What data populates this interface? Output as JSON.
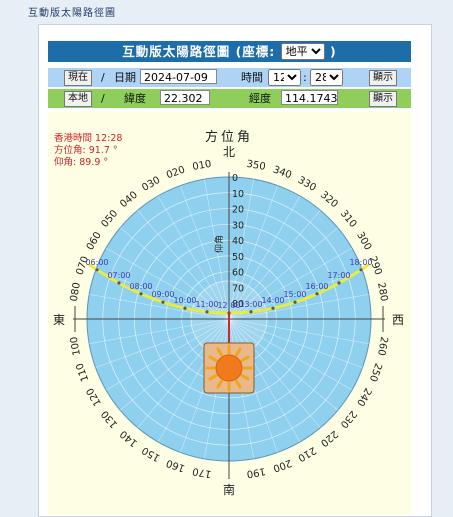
{
  "page_title": "互動版太陽路徑圖",
  "header": {
    "title": "互動版太陽路徑圖 (座標:",
    "coord_select": "地平",
    "close_paren": ")"
  },
  "row1": {
    "now_button": "現在",
    "sep": "/",
    "date_label": "日期",
    "date_value": "2024-07-09",
    "time_label": "時間",
    "hour": "12",
    "colon": ":",
    "minute": "28",
    "show_button": "顯示"
  },
  "row2": {
    "local_button": "本地",
    "sep": "/",
    "lat_label": "緯度",
    "lat_value": "22.302",
    "lon_label": "經度",
    "lon_value": "114.1743",
    "show_button": "顯示"
  },
  "info": {
    "time_label": "香港時間",
    "time_value": "12:28",
    "azimuth_label": "方位角",
    "azimuth_value": ": 91.7 °",
    "elevation_label": "仰角",
    "elevation_value": ": 89.9 °"
  },
  "diagram": {
    "azimuth_title": "方位角",
    "elevation_title": "仰角",
    "north": "北",
    "east": "東",
    "south": "南",
    "west": "西",
    "azimuth_labels": [
      "010",
      "020",
      "030",
      "040",
      "050",
      "060",
      "070",
      "080",
      "100",
      "110",
      "120",
      "130",
      "140",
      "150",
      "160",
      "170",
      "190",
      "200",
      "210",
      "220",
      "230",
      "240",
      "250",
      "260",
      "280",
      "290",
      "300",
      "310",
      "320",
      "330",
      "340",
      "350"
    ],
    "elevation_labels": [
      "0",
      "10",
      "20",
      "30",
      "40",
      "50",
      "60",
      "70",
      "80"
    ],
    "hour_labels": [
      "06:00",
      "07:00",
      "08:00",
      "09:00",
      "10:00",
      "11:00",
      "12:00",
      "13:00",
      "14:00",
      "15:00",
      "16:00",
      "17:00",
      "18:00"
    ],
    "colors": {
      "dome": "#8fd0ee",
      "path": "#e8ec40",
      "hour_label": "#3f3fae",
      "info": "#d3242b",
      "sun_box": "#e8b98a"
    }
  }
}
